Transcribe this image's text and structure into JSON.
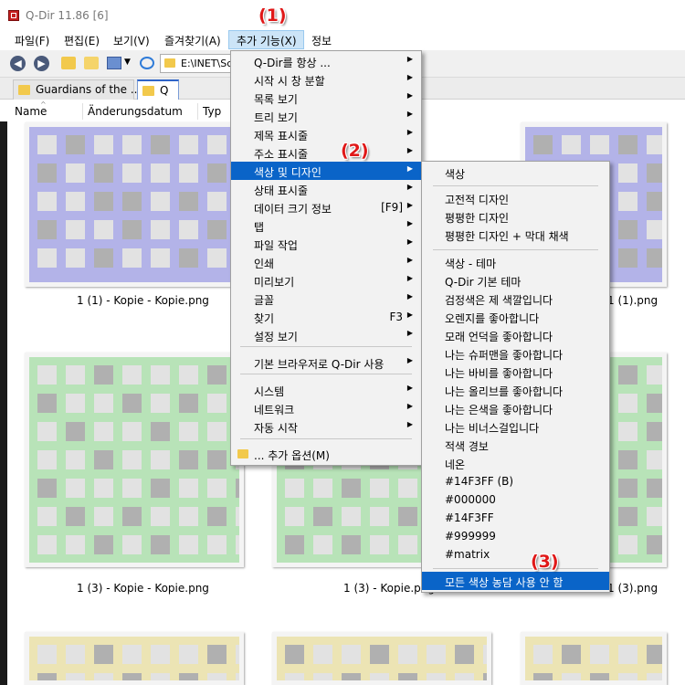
{
  "window": {
    "title": "Q-Dir 11.86 [6]"
  },
  "menubar": {
    "items": [
      "파일(F)",
      "편집(E)",
      "보기(V)",
      "즐겨찾기(A)",
      "추가 기능(X)",
      "정보"
    ]
  },
  "toolbar": {
    "address": "E:\\INET\\Sc"
  },
  "tabs": [
    "Guardians of the ...",
    "Q"
  ],
  "columns": [
    "Name",
    "Änderungsdatum",
    "Typ"
  ],
  "files": [
    "1 (1) - Kopie - Kopie.png",
    "1 (1).png",
    "1 (3) - Kopie - Kopie.png",
    "1 (3) - Kopie.png",
    "1 (3).png"
  ],
  "extras_menu": {
    "items": [
      {
        "label": "Q-Dir를 항상 ...",
        "submenu": true
      },
      {
        "label": "시작 시 창 분할",
        "submenu": true
      },
      {
        "label": "목록 보기",
        "submenu": true
      },
      {
        "label": "트리 보기",
        "submenu": true
      },
      {
        "label": "제목 표시줄",
        "submenu": true
      },
      {
        "label": "주소 표시줄",
        "submenu": true
      },
      {
        "label": "색상 및 디자인",
        "submenu": true,
        "highlighted": true
      },
      {
        "label": "상태 표시줄",
        "submenu": true
      },
      {
        "label": "데이터 크기 정보",
        "shortcut": "[F9]",
        "submenu": true
      },
      {
        "label": "탭",
        "submenu": true
      },
      {
        "label": "파일 작업",
        "submenu": true
      },
      {
        "label": "인쇄",
        "submenu": true
      },
      {
        "label": "미리보기",
        "submenu": true
      },
      {
        "label": "글꼴",
        "submenu": true
      },
      {
        "label": "찾기",
        "shortcut": "F3",
        "submenu": true
      },
      {
        "label": "설정 보기",
        "submenu": true
      },
      {
        "label": "기본 브라우저로 Q-Dir 사용",
        "submenu": true
      },
      {
        "label": "시스템",
        "submenu": true
      },
      {
        "label": "네트워크",
        "submenu": true
      },
      {
        "label": "자동 시작",
        "submenu": true
      },
      {
        "label": "... 추가 옵션(M)",
        "submenu": false
      }
    ]
  },
  "color_menu": {
    "items": [
      "색상",
      "고전적 디자인",
      "평평한 디자인",
      "평평한 디자인 + 막대 채색",
      "색상 - 테마",
      "Q-Dir 기본 테마",
      "검정색은 제 색깔입니다",
      "오렌지를 좋아합니다",
      "모래 언덕을 좋아합니다",
      "나는 슈퍼맨을 좋아합니다",
      "나는 바비를 좋아합니다",
      "나는 올리브를 좋아합니다",
      "나는 은색을 좋아합니다",
      "나는 비너스걸입니다",
      "적색 경보",
      "네온",
      "#14F3FF (B)",
      "#000000",
      "#14F3FF",
      "#999999",
      "#matrix",
      "모든 색상 농담 사용 안 함"
    ],
    "highlighted_index": 21
  },
  "callouts": [
    "(1)",
    "(2)",
    "(3)"
  ],
  "colors": {
    "highlight": "#0a64c8",
    "menu_hover": "#cce4f7",
    "thumb_purple": "#b3b3e8",
    "thumb_green": "#b8e3b8",
    "thumb_yellow": "#ece4b4",
    "cell_light": "#e2e2e2",
    "cell_dark": "#b0b0b0",
    "callout": "#e01818"
  }
}
